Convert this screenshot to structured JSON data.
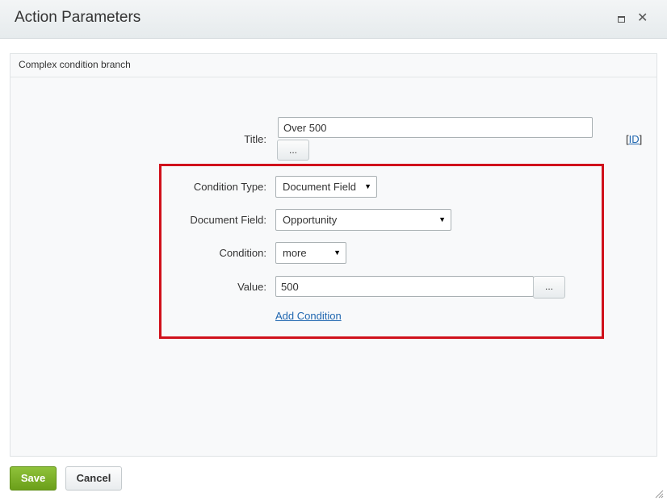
{
  "dialog": {
    "title": "Action Parameters",
    "maximize_icon": "maximize-icon",
    "close_icon": "close-icon",
    "close_glyph": "✕"
  },
  "panel": {
    "header": "Complex condition branch"
  },
  "form": {
    "title_label": "Title:",
    "title_value": "Over 500",
    "title_dots": "...",
    "id_link_open": "[",
    "id_link": "ID",
    "id_link_close": "]",
    "condition_type_label": "Condition Type:",
    "condition_type_value": "Document Field",
    "document_field_label": "Document Field:",
    "document_field_value": "Opportunity",
    "condition_label": "Condition:",
    "condition_value": "more",
    "value_label": "Value:",
    "value_value": "500",
    "value_dots": "...",
    "add_condition": "Add Condition"
  },
  "footer": {
    "save": "Save",
    "cancel": "Cancel"
  },
  "colors": {
    "highlight": "#d0111b",
    "link": "#2067b0",
    "save_button": "#7cb02a"
  }
}
